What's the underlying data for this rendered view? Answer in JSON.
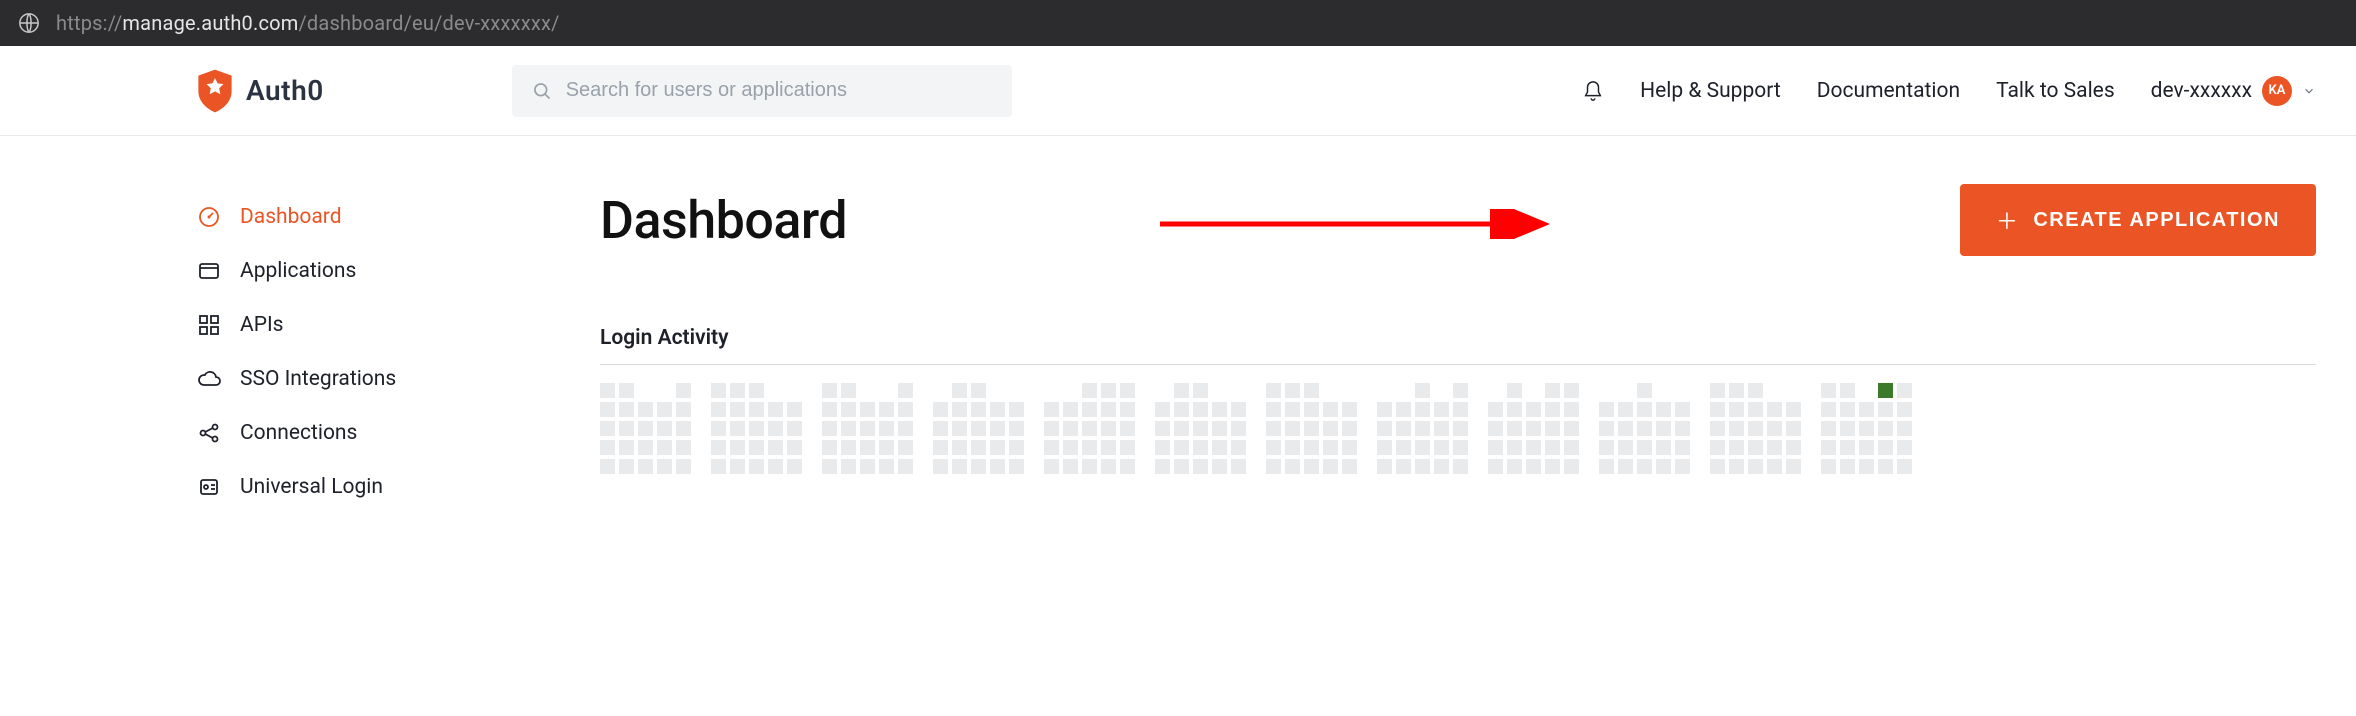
{
  "browser": {
    "url_prefix": "https://",
    "url_host": "manage.auth0.com",
    "url_path": "/dashboard/eu/dev-xxxxxxx/"
  },
  "brand": {
    "name": "Auth0"
  },
  "search": {
    "placeholder": "Search for users or applications"
  },
  "header": {
    "help": "Help & Support",
    "docs": "Documentation",
    "sales": "Talk to Sales",
    "tenant": "dev-xxxxxx",
    "avatar_initials": "KA"
  },
  "sidebar": {
    "items": [
      {
        "label": "Dashboard"
      },
      {
        "label": "Applications"
      },
      {
        "label": "APIs"
      },
      {
        "label": "SSO Integrations"
      },
      {
        "label": "Connections"
      },
      {
        "label": "Universal Login"
      }
    ]
  },
  "main": {
    "title": "Dashboard",
    "create_button": "CREATE APPLICATION",
    "section_title": "Login Activity"
  },
  "colors": {
    "accent": "#eb5424",
    "arrow": "#ff0000"
  },
  "chart_data": {
    "type": "heatmap",
    "title": "Login Activity",
    "note": "Contribution-style calendar grid; values unreadable from screenshot except one highlighted cell.",
    "columns_visible": 12,
    "rows_visible_approx": 5,
    "highlighted_cells": 1
  }
}
